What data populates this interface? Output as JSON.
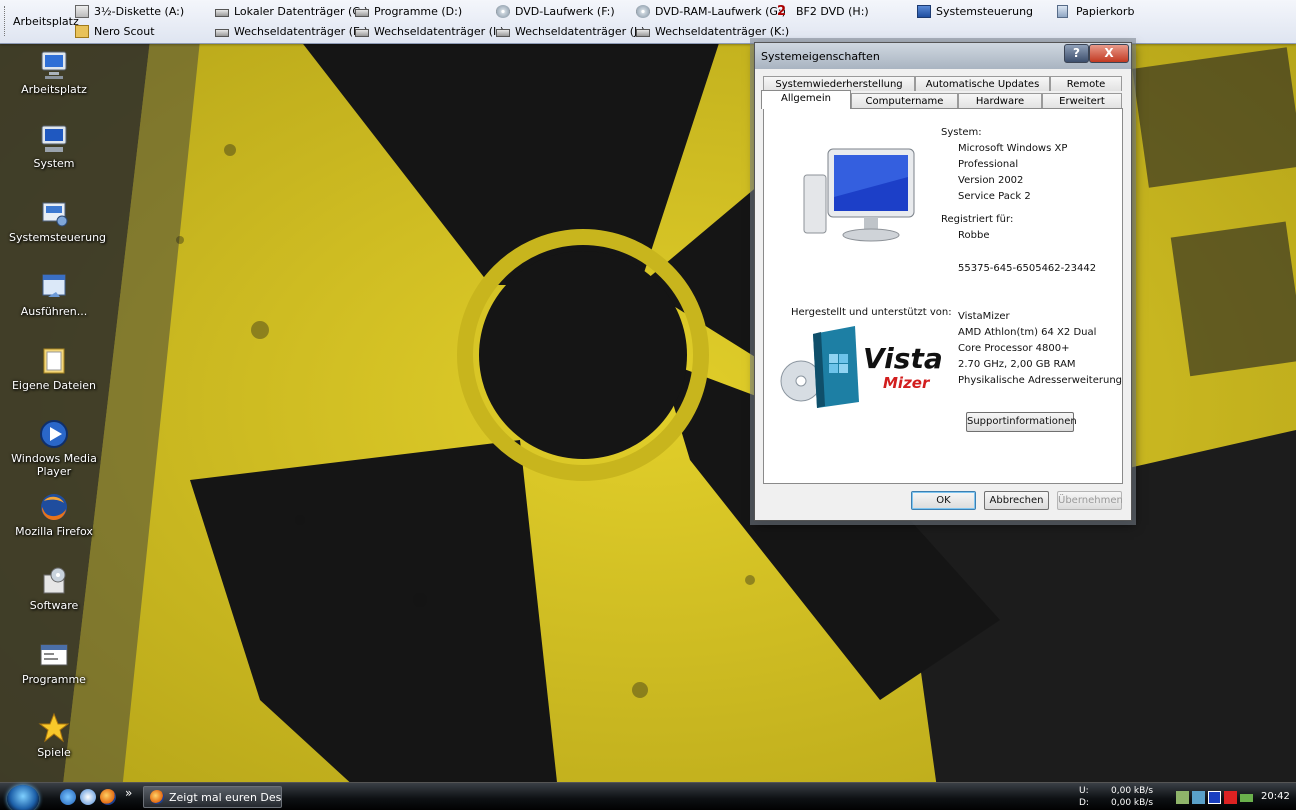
{
  "toolbar": {
    "title": "Arbeitsplatz",
    "items": [
      {
        "label": "3½-Diskette (A:)",
        "icon": "floppy-icon"
      },
      {
        "label": "Lokaler Datenträger (C:)",
        "icon": "drive-icon"
      },
      {
        "label": "Programme (D:)",
        "icon": "drive-icon"
      },
      {
        "label": "DVD-Laufwerk (F:)",
        "icon": "dvd-drive-icon"
      },
      {
        "label": "DVD-RAM-Laufwerk (G:)",
        "icon": "dvd-drive-icon"
      },
      {
        "label": "BF2 DVD (H:)",
        "icon": "bf2-icon"
      },
      {
        "label": "Systemsteuerung",
        "icon": "control-panel-icon"
      },
      {
        "label": "Papierkorb",
        "icon": "recycle-bin-icon"
      },
      {
        "label": "Nero Scout",
        "icon": "nero-scout-icon"
      },
      {
        "label": "Wechseldatenträger (E:)",
        "icon": "removable-drive-icon"
      },
      {
        "label": "Wechseldatenträger (I:)",
        "icon": "removable-drive-icon"
      },
      {
        "label": "Wechseldatenträger (J:)",
        "icon": "removable-drive-icon"
      },
      {
        "label": "Wechseldatenträger (K:)",
        "icon": "removable-drive-icon"
      }
    ]
  },
  "desktop_icons": [
    {
      "label": "Arbeitsplatz",
      "icon": "computer-icon"
    },
    {
      "label": "System",
      "icon": "system-icon"
    },
    {
      "label": "Systemsteuerung",
      "icon": "control-panel-icon"
    },
    {
      "label": "Ausführen...",
      "icon": "run-icon"
    },
    {
      "label": "Eigene Dateien",
      "icon": "documents-folder-icon"
    },
    {
      "label": "Windows Media Player",
      "icon": "media-player-icon"
    },
    {
      "label": "Mozilla Firefox",
      "icon": "firefox-icon"
    },
    {
      "label": "Software",
      "icon": "software-icon"
    },
    {
      "label": "Programme",
      "icon": "programs-icon"
    },
    {
      "label": "Spiele",
      "icon": "games-star-icon"
    }
  ],
  "wallpaper": {
    "text": "RADIOACTIVE",
    "colors": {
      "yellow": "#d6c21d",
      "black": "#151515"
    }
  },
  "dialog": {
    "title": "Systemeigenschaften",
    "help_label": "?",
    "close_label": "X",
    "tabs_back": [
      "Systemwiederherstellung",
      "Automatische Updates",
      "Remote"
    ],
    "tabs_front": [
      "Allgemein",
      "Computername",
      "Hardware",
      "Erweitert"
    ],
    "active_tab": "Allgemein",
    "system_heading": "System:",
    "system_lines": [
      "Microsoft Windows XP",
      "Professional",
      "Version 2002",
      "Service Pack 2"
    ],
    "registered_heading": "Registriert für:",
    "registered_user": "Robbe",
    "product_id": "55375-645-6505462-23442",
    "manufacturer_heading": "Hergestellt und unterstützt von:",
    "manufacturer_lines": [
      "VistaMizer",
      "AMD Athlon(tm) 64 X2 Dual",
      "Core Processor 4800+",
      "2.70 GHz, 2,00 GB RAM",
      "Physikalische Adresserweiterung"
    ],
    "logo_text_1": "Vista",
    "logo_text_2": "Mizer",
    "support_button": "Supportinformationen",
    "buttons": {
      "ok": "OK",
      "cancel": "Abbrechen",
      "apply": "Übernehmen"
    }
  },
  "taskbar": {
    "task_label": "Zeigt mal euren Desk...",
    "chevron": "»",
    "net_u_label": "U:",
    "net_u_value": "0,00 kB/s",
    "net_d_label": "D:",
    "net_d_value": "0,00 kB/s",
    "clock": "20:42"
  }
}
